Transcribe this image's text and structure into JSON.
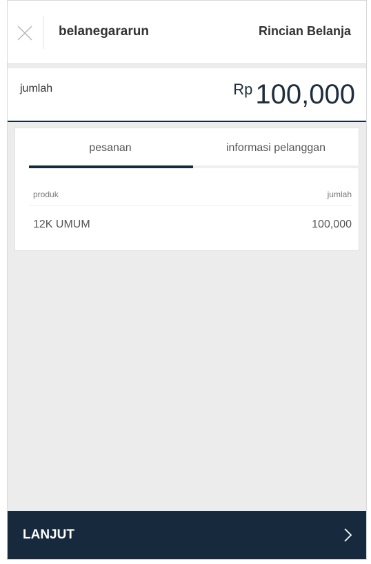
{
  "header": {
    "merchant_name": "belanegararun",
    "title": "Rincian Belanja",
    "close_icon": "close-icon"
  },
  "amount": {
    "label": "jumlah",
    "currency": "Rp",
    "value": "100,000"
  },
  "tabs": [
    {
      "label": "pesanan",
      "active": true
    },
    {
      "label": "informasi pelanggan",
      "active": false
    }
  ],
  "table": {
    "columns": [
      "produk",
      "jumlah"
    ],
    "rows": [
      {
        "product": "12K UMUM",
        "amount": "100,000"
      }
    ]
  },
  "footer": {
    "button_label": "LANJUT",
    "icon": "chevron-right-icon"
  },
  "colors": {
    "primary": "#17293d",
    "background": "#ececec",
    "card": "#ffffff"
  }
}
